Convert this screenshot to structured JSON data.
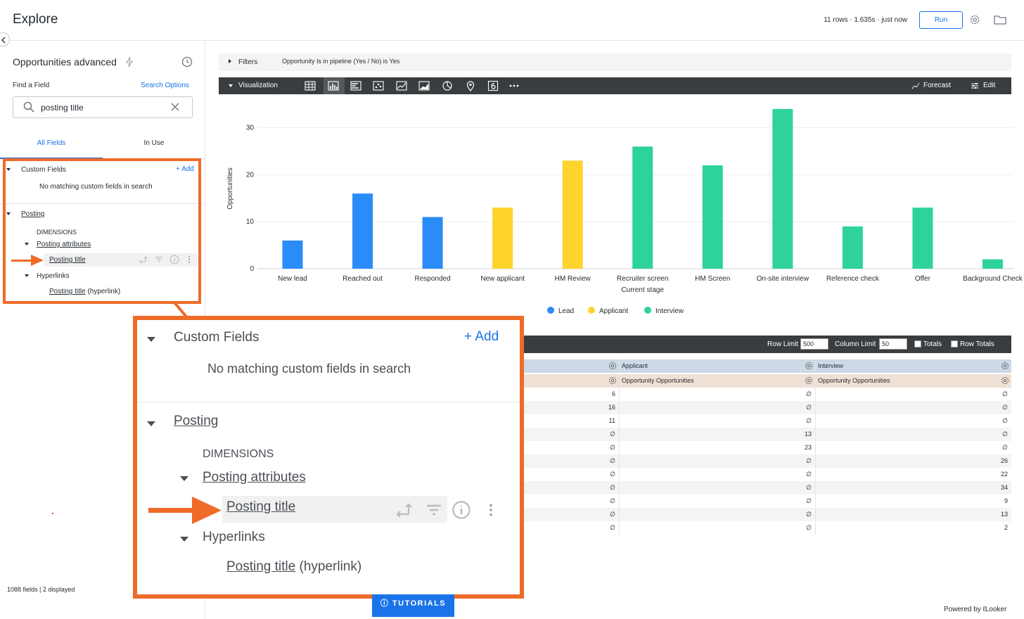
{
  "header": {
    "title": "Explore",
    "run_status": "11 rows · 1.635s · just now",
    "run_label": "Run"
  },
  "sidebar": {
    "explore_name": "Opportunities advanced",
    "find_label": "Find a Field",
    "search_options": "Search Options",
    "search_value": "posting title",
    "tabs": {
      "all": "All Fields",
      "in_use": "In Use"
    },
    "custom_fields": {
      "label": "Custom Fields",
      "add": "+ Add",
      "empty": "No matching custom fields in search"
    },
    "posting": {
      "label": "Posting",
      "dimensions": "DIMENSIONS",
      "attributes": "Posting attributes",
      "posting_title": "Posting title",
      "hyperlinks": "Hyperlinks",
      "hyperlink_link": "Posting title",
      "hyperlink_suffix": " (hyperlink)"
    },
    "footer": "1088 fields | 2 displayed"
  },
  "filters": {
    "label": "Filters",
    "text": "Opportunity Is in pipeline (Yes / No) is Yes"
  },
  "visualization": {
    "label": "Visualization",
    "forecast": "Forecast",
    "edit": "Edit"
  },
  "colors": {
    "lead": "#2a8cf7",
    "applicant": "#fdd32c",
    "interview": "#2ed39c",
    "accent": "#1a73e8",
    "highlight": "#ef6b28"
  },
  "chart_data": {
    "type": "bar",
    "categories": [
      "New lead",
      "Reached out",
      "Responded",
      "New applicant",
      "HM Review",
      "Recruiter screen\nCurrent stage",
      "HM Screen",
      "On-site interview",
      "Reference check",
      "Offer",
      "Background Check"
    ],
    "series": [
      {
        "name": "Lead",
        "values": [
          6,
          16,
          11,
          null,
          null,
          null,
          null,
          null,
          null,
          null,
          null
        ]
      },
      {
        "name": "Applicant",
        "values": [
          null,
          null,
          null,
          13,
          23,
          null,
          null,
          null,
          null,
          null,
          null
        ]
      },
      {
        "name": "Interview",
        "values": [
          null,
          null,
          null,
          null,
          null,
          26,
          22,
          34,
          9,
          13,
          2
        ]
      }
    ],
    "ylabel": "Opportunities",
    "ylim": [
      0,
      34
    ],
    "yticks": [
      0,
      10,
      20,
      30
    ],
    "legend_position": "bottom"
  },
  "data_panel": {
    "row_limit_label": "Row Limit",
    "row_limit": "500",
    "column_limit_label": "Column Limit",
    "column_limit": "50",
    "totals": "Totals",
    "row_totals": "Row Totals"
  },
  "table": {
    "pivot_headers": [
      "Applicant",
      "Interview"
    ],
    "measure_headers": [
      "Opportunity Opportunities",
      "Opportunity Opportunities"
    ],
    "null_symbol": "∅",
    "rows": [
      [
        "6",
        "∅",
        "∅"
      ],
      [
        "16",
        "∅",
        "∅"
      ],
      [
        "11",
        "∅",
        "∅"
      ],
      [
        "∅",
        "13",
        "∅"
      ],
      [
        "∅",
        "23",
        "∅"
      ],
      [
        "∅",
        "∅",
        "26"
      ],
      [
        "∅",
        "∅",
        "22"
      ],
      [
        "∅",
        "∅",
        "34"
      ],
      [
        "∅",
        "∅",
        "9"
      ],
      [
        "∅",
        "∅",
        "13"
      ],
      [
        "∅",
        "∅",
        "2"
      ]
    ]
  },
  "tutorials": "TUTORIALS",
  "powered_by": "Powered by",
  "brand": "Looker"
}
